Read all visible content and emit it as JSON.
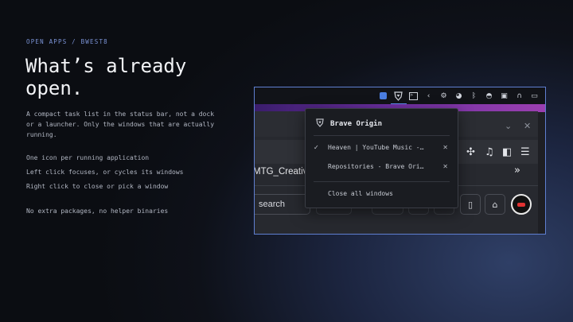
{
  "eyebrow": "OPEN APPS / BWEST8",
  "headline_line1": "What’s already",
  "headline_line2": "open.",
  "subtitle": "A compact task list in the status bar, not a dock or a launcher. Only the windows that are actually running.",
  "features": [
    "One icon per running application",
    "Left click focuses, or cycles its windows",
    "Right click to close or pick a window",
    "No extra packages, no helper binaries"
  ],
  "colors": {
    "accent": "#5b8cf0",
    "frame": "#5f7fd1",
    "eyebrow": "#7b93d6"
  },
  "statusbar": {
    "icons": [
      "app-square-icon",
      "brave-lion-icon",
      "terminal-icon",
      "chevron-left-icon",
      "settings-icon",
      "steam-icon",
      "bluetooth-icon",
      "gamepad-icon",
      "display-icon",
      "headphones-icon",
      "monitor-icon"
    ]
  },
  "popup": {
    "app_name": "Brave Origin",
    "windows": [
      {
        "title": "Heaven | YouTube Music -…",
        "focused": true
      },
      {
        "title": "Repositories - Brave Ori…",
        "focused": false
      }
    ],
    "close_all": "Close all windows"
  },
  "browser": {
    "bookmark": "MTG_Creativ",
    "search_placeholder": "search"
  }
}
